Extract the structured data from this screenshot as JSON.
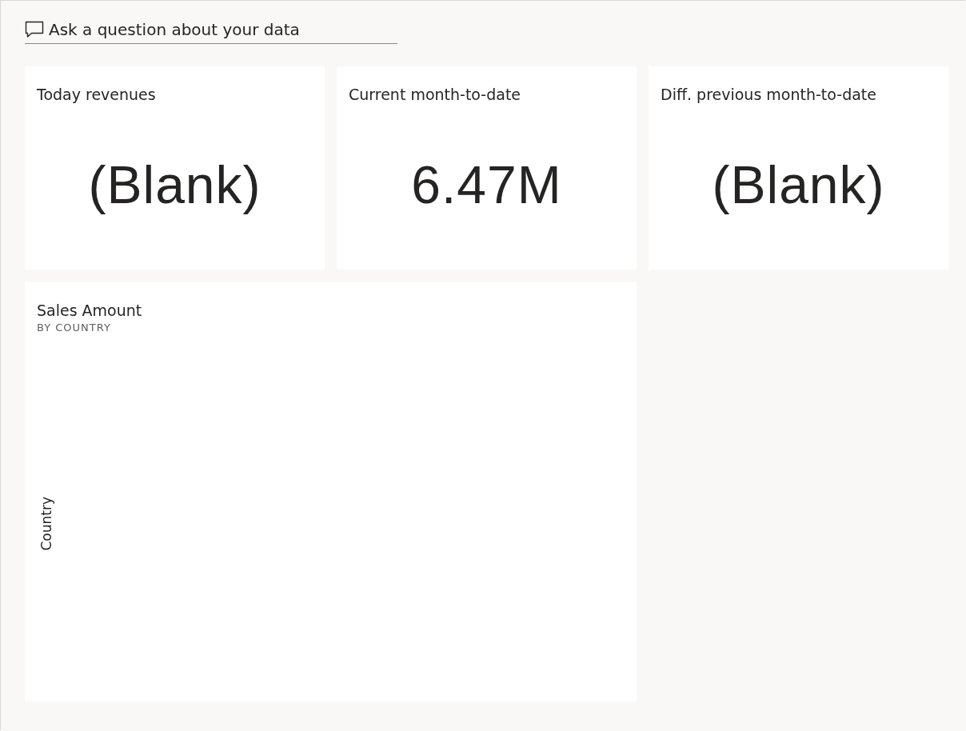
{
  "qna": {
    "placeholder": "Ask a question about your data"
  },
  "cards": [
    {
      "title": "Today revenues",
      "value": "(Blank)"
    },
    {
      "title": "Current month-to-date",
      "value": "6.47M"
    },
    {
      "title": "Diff. previous month-to-date",
      "value": "(Blank)"
    }
  ],
  "chart": {
    "title": "Sales Amount",
    "subtitle": "BY COUNTRY",
    "ylabel": "Country"
  }
}
